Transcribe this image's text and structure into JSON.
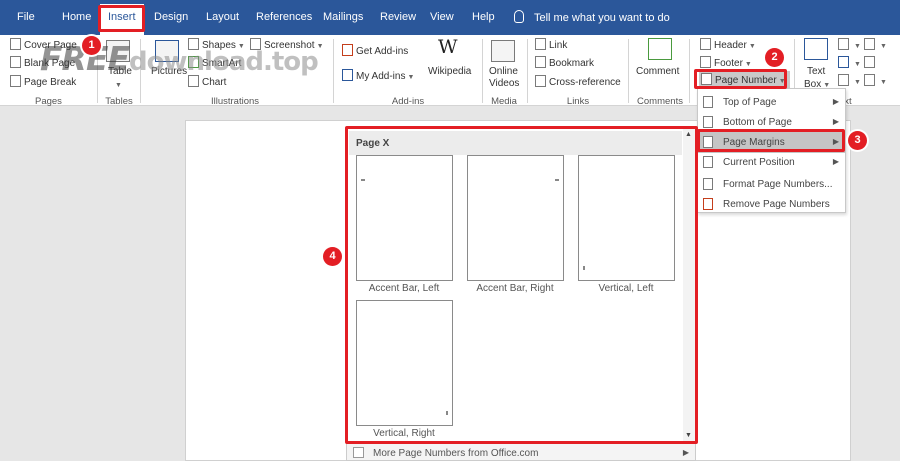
{
  "tabs": [
    {
      "label": "File"
    },
    {
      "label": "Home"
    },
    {
      "label": "Insert"
    },
    {
      "label": "Design"
    },
    {
      "label": "Layout"
    },
    {
      "label": "References"
    },
    {
      "label": "Mailings"
    },
    {
      "label": "Review"
    },
    {
      "label": "View"
    },
    {
      "label": "Help"
    }
  ],
  "tell_me": "Tell me what you want to do",
  "ribbon": {
    "pages": {
      "cover_page": "Cover Page",
      "blank_page": "Blank Page",
      "page_break": "Page Break",
      "group": "Pages"
    },
    "tables": {
      "table": "Table",
      "group": "Tables"
    },
    "illustrations": {
      "pictures": "Pictures",
      "shapes": "Shapes",
      "smartart": "SmartArt",
      "chart": "Chart",
      "screenshot": "Screenshot",
      "group": "Illustrations"
    },
    "addins": {
      "get_addins": "Get Add-ins",
      "my_addins": "My Add-ins",
      "wikipedia": "Wikipedia",
      "group": "Add-ins"
    },
    "media": {
      "online_videos_1": "Online",
      "online_videos_2": "Videos",
      "group": "Media"
    },
    "links": {
      "link": "Link",
      "bookmark": "Bookmark",
      "cross_reference": "Cross-reference",
      "group": "Links"
    },
    "comments": {
      "comment": "Comment",
      "group": "Comments"
    },
    "header_footer": {
      "header": "Header",
      "footer": "Footer",
      "page_number": "Page Number"
    },
    "text": {
      "text_box_1": "Text",
      "text_box_2": "Box",
      "group_fragment": "xt"
    }
  },
  "watermark": {
    "part1": "FREE",
    "part2": "download",
    "part3": ".top"
  },
  "page_number_menu": [
    {
      "label": "Top of Page"
    },
    {
      "label": "Bottom of Page"
    },
    {
      "label": "Page Margins"
    },
    {
      "label": "Current Position"
    },
    {
      "label": "Format Page Numbers..."
    },
    {
      "label": "Remove Page Numbers"
    }
  ],
  "gallery": {
    "heading": "Page X",
    "items": [
      {
        "label": "Accent Bar, Left"
      },
      {
        "label": "Accent Bar, Right"
      },
      {
        "label": "Vertical, Left"
      },
      {
        "label": "Vertical, Right"
      }
    ],
    "more": "More Page Numbers from Office.com"
  },
  "badges": [
    "1",
    "2",
    "3",
    "4"
  ],
  "colors": {
    "accent": "#2b579a",
    "annotation": "#e31e24"
  }
}
